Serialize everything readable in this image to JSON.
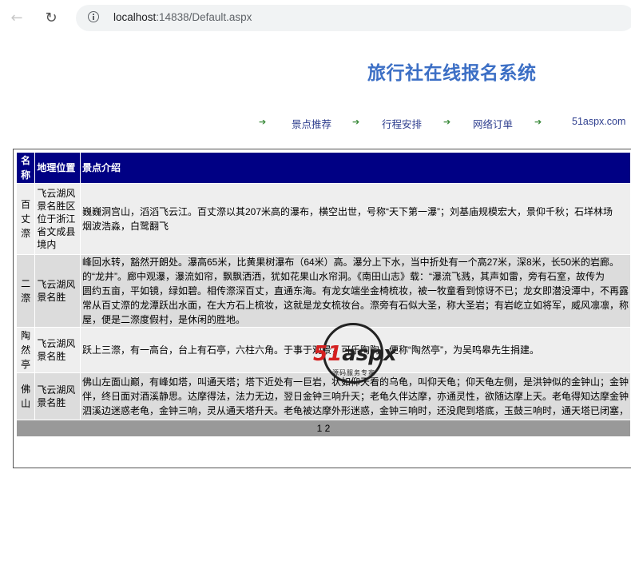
{
  "browser": {
    "url_host": "localhost",
    "url_rest": ":14838/Default.aspx"
  },
  "page": {
    "title": "旅行社在线报名系统",
    "nav": [
      "景点推荐",
      "行程安排",
      "网络订单",
      "51aspx.com"
    ]
  },
  "table": {
    "headers": [
      "名称",
      "地理位置",
      "景点介绍"
    ],
    "rows": [
      {
        "name": "百丈漈",
        "location": "飞云湖风景名胜区位于浙江省文成县境内",
        "intro": [
          "巍巍洞宫山，滔滔飞云江。百丈漈以其207米高的瀑布，横空出世，号称“天下第一瀑”；刘基庙规模宏大，景仰千秋；石垟林场",
          "烟波浩淼，白鹭翻飞"
        ]
      },
      {
        "name": "二漈",
        "location": "飞云湖风景名胜",
        "intro": [
          "峰回水转，豁然开朗处。瀑高65米，比黄果树瀑布（64米）高。瀑分上下水，当中折处有一个高27米，深8米，长50米的岩廊。",
          "的“龙井”。廊中观瀑，瀑流如帘，飘飘洒洒，犹如花果山水帘洞。《南田山志》载：“瀑流飞溅，其声如雷，旁有石室，故传为",
          "圆约五亩，平如镜，绿如碧。相传漈深百丈，直通东海。有龙女端坐金椅梳妆，被一牧童看到惊讶不已；龙女即潜没潭中，不再露",
          "常从百丈漈的龙潭跃出水面，在大方石上梳妆，这就是龙女梳妆台。漈旁有石似大圣，称大圣岩；有岩屹立如将军，威风凛凛，称",
          "屋，便是二漈度假村，是休闲的胜地。"
        ]
      },
      {
        "name": "陶然亭",
        "location": "飞云湖风景名胜",
        "intro": [
          "跃上三漈，有一高台，台上有石亭，六柱六角。于事于观景，可乐陶陶，便称“陶然亭”，为吴鸣皋先生捐建。"
        ]
      },
      {
        "name": "佛山",
        "location": "飞云湖风景名胜",
        "intro": [
          "佛山左面山巅，有峰如塔，叫通天塔；塔下近处有一巨岩，状如仰天看的乌龟，叫仰天龟；仰天龟左侧，是洪钟似的金钟山；金钟",
          "伴，终日面对酒溪静思。达摩得法，法力无边，翌日金钟三响升天；老龟久伴达摩，亦通灵性，欲随达摩上天。老龟得知达摩金钟",
          "泗溪边迷惑老龟，金钟三响，灵从通天塔升天。老龟被达摩外形迷惑，金钟三响时，还没爬到塔底，玉鼓三响时，通天塔已闭塞，"
        ]
      }
    ],
    "pager": "1 2"
  },
  "watermark": {
    "brand_51": "51",
    "brand_aspx": "aspx",
    "subtitle": "源码服务专家"
  }
}
